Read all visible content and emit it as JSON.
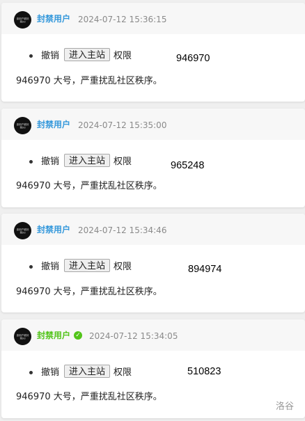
{
  "posts": [
    {
      "avatar_text": "该用户被封禁/id",
      "username": "封禁用户",
      "username_color": "#3498db",
      "verified": false,
      "timestamp": "2024-07-12 15:36:15",
      "action_prefix": "撤销",
      "button_label": "进入主站",
      "action_suffix": "权限",
      "user_id": "946970",
      "reason": "946970 大号，严重扰乱社区秩序。"
    },
    {
      "avatar_text": "该用户被封禁/id",
      "username": "封禁用户",
      "username_color": "#3498db",
      "verified": false,
      "timestamp": "2024-07-12 15:35:00",
      "action_prefix": "撤销",
      "button_label": "进入主站",
      "action_suffix": "权限",
      "user_id": "965248",
      "reason": "946970 大号，严重扰乱社区秩序。"
    },
    {
      "avatar_text": "该用户被封禁/id",
      "username": "封禁用户",
      "username_color": "#3498db",
      "verified": false,
      "timestamp": "2024-07-12 15:34:46",
      "action_prefix": "撤销",
      "button_label": "进入主站",
      "action_suffix": "权限",
      "user_id": "894974",
      "reason": "946970 大号，严重扰乱社区秩序。"
    },
    {
      "avatar_text": "该用户被封禁/id",
      "username": "封禁用户",
      "username_color": "#52c41a",
      "verified": true,
      "verified_icon": "check-circle-icon",
      "timestamp": "2024-07-12 15:34:05",
      "action_prefix": "撤销",
      "button_label": "进入主站",
      "action_suffix": "权限",
      "user_id": "510823",
      "reason": "946970 大号，严重扰乱社区秩序。"
    }
  ],
  "watermark": "洛谷"
}
